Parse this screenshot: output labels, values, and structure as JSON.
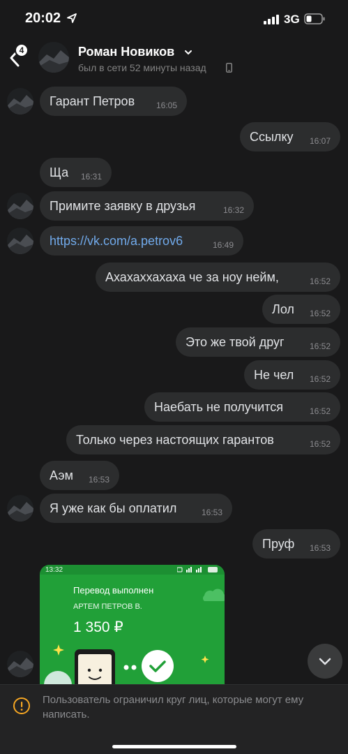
{
  "status_bar": {
    "time": "20:02",
    "network": "3G"
  },
  "header": {
    "back_badge": "4",
    "name": "Роман Новиков",
    "status": "был в сети 52 минуты назад"
  },
  "messages": [
    {
      "text": "Гарант Петров",
      "time": "16:05",
      "side": "in"
    },
    {
      "text": "Ссылку",
      "time": "16:07",
      "side": "out"
    },
    {
      "text": "Ща",
      "time": "16:31",
      "side": "in"
    },
    {
      "text": "Примите заявку в друзья",
      "time": "16:32",
      "side": "in"
    },
    {
      "text": "https://vk.com/a.petrov6",
      "time": "16:49",
      "side": "in"
    },
    {
      "text": "Ахахаххахаха че за ноу нейм,",
      "time": "16:52",
      "side": "out"
    },
    {
      "text": "Лол",
      "time": "16:52",
      "side": "out"
    },
    {
      "text": "Это же твой друг",
      "time": "16:52",
      "side": "out"
    },
    {
      "text": "Не чел",
      "time": "16:52",
      "side": "out"
    },
    {
      "text": "Наебать не получится",
      "time": "16:52",
      "side": "out"
    },
    {
      "text": "Только через настоящих гарантов",
      "time": "16:52",
      "side": "out"
    },
    {
      "text": "Аэм",
      "time": "16:53",
      "side": "in"
    },
    {
      "text": "Я уже как бы оплатил",
      "time": "16:53",
      "side": "in"
    },
    {
      "text": "Пруф",
      "time": "16:53",
      "side": "out"
    }
  ],
  "image_message": {
    "time": "13:32",
    "title": "Перевод выполнен",
    "recipient": "АРТЕМ ПЕТРОВ В.",
    "amount": "1 350 ₽"
  },
  "footer": {
    "notice": "Пользователь ограничил круг лиц, которые могут ему написать."
  },
  "colors": {
    "background": "#19191a",
    "bubble": "#2c2d2e",
    "link": "#71aaeb",
    "warning": "#f5a623",
    "sber_green": "#21a038"
  }
}
